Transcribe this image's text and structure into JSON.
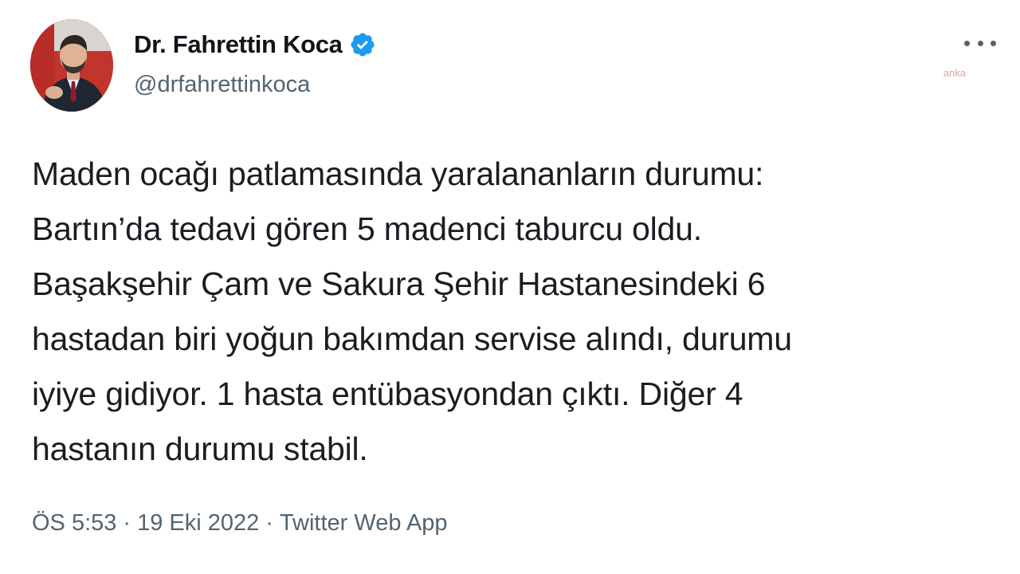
{
  "author": {
    "display_name": "Dr. Fahrettin Koca",
    "handle": "@drfahrettinkoca",
    "verified": true,
    "verified_color": "#1d9bf0"
  },
  "watermark": "anka",
  "tweet": {
    "text": "Maden ocağı patlamasında yaralananların durumu:\nBartın’da tedavi gören 5 madenci taburcu oldu.\nBaşakşehir Çam ve Sakura Şehir Hastanesindeki 6\nhastadan biri yoğun bakımdan servise alındı, durumu\niyiye gidiyor. 1 hasta entübasyondan çıktı. Diğer 4\nhastanın durumu stabil."
  },
  "meta": {
    "time": "ÖS 5:53",
    "separator": "·",
    "date": "19 Eki 2022",
    "source": "Twitter Web App"
  },
  "colors": {
    "text_primary": "#0f1419",
    "text_secondary": "#536471",
    "accent": "#1d9bf0",
    "avatar_bg": "#b8302b"
  }
}
